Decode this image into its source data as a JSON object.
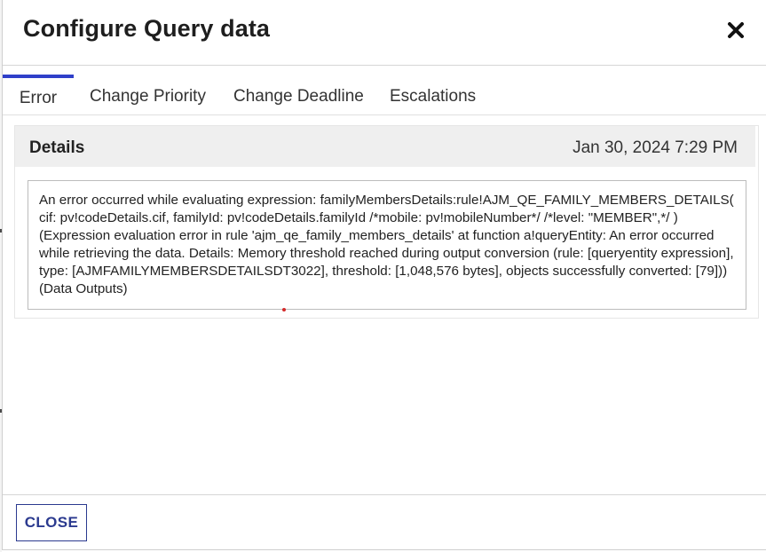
{
  "dialog": {
    "title": "Configure Query data",
    "close_icon": "close-x-icon"
  },
  "tabs": [
    {
      "label": "Error",
      "active": true
    },
    {
      "label": "Change Priority",
      "active": false
    },
    {
      "label": "Change Deadline",
      "active": false
    },
    {
      "label": "Escalations",
      "active": false
    }
  ],
  "details": {
    "title": "Details",
    "timestamp": "Jan 30, 2024 7:29 PM",
    "message": "An error occurred while evaluating expression: familyMembersDetails:rule!AJM_QE_FAMILY_MEMBERS_DETAILS( cif: pv!codeDetails.cif, familyId: pv!codeDetails.familyId /*mobile: pv!mobileNumber*/ /*level: \"MEMBER\",*/ ) (Expression evaluation error in rule 'ajm_qe_family_members_details' at function a!queryEntity: An error occurred while retrieving the data. Details: Memory threshold reached during output conversion (rule: [queryentity expression], type: [AJMFAMILYMEMBERSDETAILSDT3022], threshold: [1,048,576 bytes], objects successfully converted: [79])) (Data Outputs)"
  },
  "footer": {
    "close_label": "CLOSE"
  },
  "colors": {
    "accent": "#2f3fc9",
    "button_text": "#2b3a8f",
    "card_header_bg": "#efefef"
  }
}
